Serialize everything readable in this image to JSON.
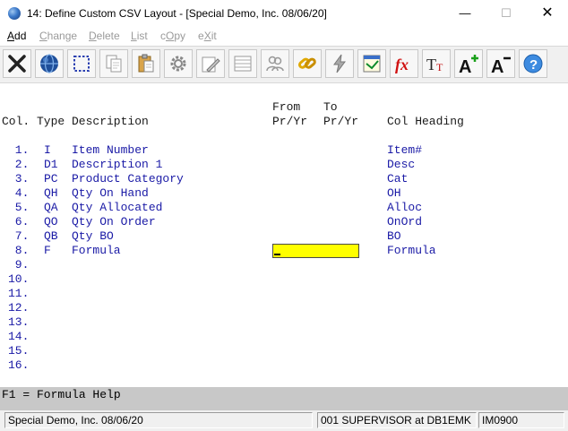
{
  "window": {
    "title": "14: Define Custom CSV Layout - [Special Demo, Inc. 08/06/20]",
    "minimize": "—",
    "maximize": "☐",
    "close": "✕"
  },
  "menu": [
    {
      "pre": "",
      "u": "A",
      "post": "dd",
      "enabled": true
    },
    {
      "pre": "",
      "u": "C",
      "post": "hange",
      "enabled": false
    },
    {
      "pre": "",
      "u": "D",
      "post": "elete",
      "enabled": false
    },
    {
      "pre": "",
      "u": "L",
      "post": "ist",
      "enabled": false
    },
    {
      "pre": "c",
      "u": "O",
      "post": "py",
      "enabled": false
    },
    {
      "pre": "e",
      "u": "X",
      "post": "it",
      "enabled": false
    }
  ],
  "toolbar": {
    "icons": [
      "cancel-icon",
      "globe-icon",
      "select-box-icon",
      "copy-icon",
      "paste-icon",
      "settings-icon",
      "edit-icon",
      "list-icon",
      "users-icon",
      "link-icon",
      "lightning-icon",
      "notes-icon",
      "formula-icon",
      "font-size-icon",
      "increase-font-icon",
      "decrease-font-icon",
      "help-icon"
    ]
  },
  "form": {
    "headers": {
      "from_top": "From",
      "to_top": "To",
      "col": "Col.",
      "type": "Type",
      "description": "Description",
      "from_bottom": "Pr/Yr",
      "to_bottom": "Pr/Yr",
      "col_heading": "Col Heading"
    },
    "rows": [
      {
        "num": " 1.",
        "type": "I",
        "desc": "Item Number",
        "heading": "Item#"
      },
      {
        "num": " 2.",
        "type": "D1",
        "desc": "Description 1",
        "heading": "Desc"
      },
      {
        "num": " 3.",
        "type": "PC",
        "desc": "Product Category",
        "heading": "Cat"
      },
      {
        "num": " 4.",
        "type": "QH",
        "desc": "Qty On Hand",
        "heading": "OH"
      },
      {
        "num": " 5.",
        "type": "QA",
        "desc": "Qty Allocated",
        "heading": "Alloc"
      },
      {
        "num": " 6.",
        "type": "QO",
        "desc": "Qty On Order",
        "heading": "OnOrd"
      },
      {
        "num": " 7.",
        "type": "QB",
        "desc": "Qty BO",
        "heading": "BO"
      },
      {
        "num": " 8.",
        "type": "F",
        "desc": "Formula",
        "heading": "Formula"
      },
      {
        "num": " 9.",
        "type": "",
        "desc": "",
        "heading": ""
      },
      {
        "num": "10.",
        "type": "",
        "desc": "",
        "heading": ""
      },
      {
        "num": "11.",
        "type": "",
        "desc": "",
        "heading": ""
      },
      {
        "num": "12.",
        "type": "",
        "desc": "",
        "heading": ""
      },
      {
        "num": "13.",
        "type": "",
        "desc": "",
        "heading": ""
      },
      {
        "num": "14.",
        "type": "",
        "desc": "",
        "heading": ""
      },
      {
        "num": "15.",
        "type": "",
        "desc": "",
        "heading": ""
      },
      {
        "num": "16.",
        "type": "",
        "desc": "",
        "heading": ""
      }
    ],
    "active_field_value": ""
  },
  "help_line": "F1 = Formula Help",
  "status": {
    "company": "Special Demo, Inc. 08/06/20",
    "user": "001 SUPERVISOR at DB1EMK",
    "program": "IM0900"
  }
}
